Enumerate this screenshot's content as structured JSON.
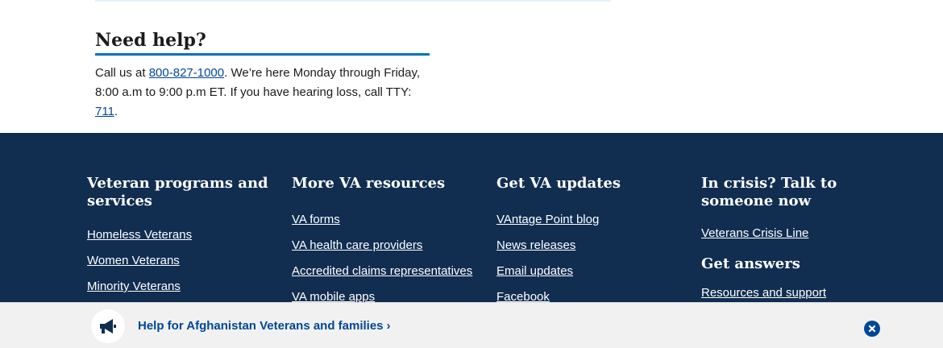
{
  "need_help": {
    "title": "Need help?",
    "call_prefix": "Call us at ",
    "phone": "800-827-1000",
    "text_mid": ". We’re here Monday through Friday, 8:00 a.m to 9:00 p.m ET. If you have hearing loss, call TTY: ",
    "tty": "711",
    "text_end": "."
  },
  "footer": {
    "columns": [
      {
        "title": "Veteran programs and services",
        "links": [
          "Homeless Veterans",
          "Women Veterans",
          "Minority Veterans"
        ]
      },
      {
        "title": "More VA resources",
        "links": [
          "VA forms",
          "VA health care providers",
          "Accredited claims representatives",
          "VA mobile apps"
        ]
      },
      {
        "title": "Get VA updates",
        "links": [
          "VAntage Point blog",
          "News releases",
          "Email updates",
          "Facebook"
        ]
      },
      {
        "title": "In crisis? Talk to someone now",
        "links": [
          "Veterans Crisis Line"
        ],
        "subtitle": "Get answers",
        "sublinks": [
          "Resources and support"
        ]
      }
    ]
  },
  "banner": {
    "icon": "megaphone-icon",
    "link_label": "Help for Afghanistan Veterans and families",
    "chevron": "›",
    "close_icon": "close-icon"
  },
  "colors": {
    "footer_bg": "#112e51",
    "link_blue": "#004795",
    "accent_underline": "#0071bb",
    "banner_bg": "#f1f1f1"
  }
}
